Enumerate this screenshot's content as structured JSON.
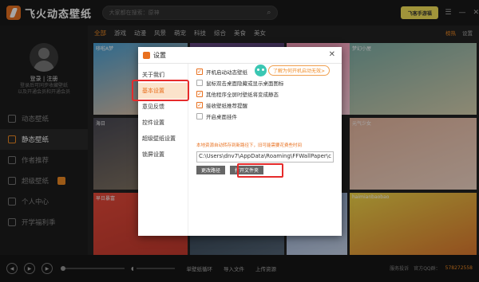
{
  "app": {
    "title": "飞火动态壁纸"
  },
  "search": {
    "placeholder": "大家都在搜索：原神"
  },
  "promo": {
    "label": "飞客手游福"
  },
  "categories": [
    "全部",
    "游戏",
    "动漫",
    "风景",
    "萌宠",
    "科技",
    "综合",
    "美食",
    "美女"
  ],
  "header_links": [
    "榜热",
    "设置"
  ],
  "user": {
    "login": "登录 | 注册",
    "hint1": "登录后可同步收藏壁纸",
    "hint2": "以及开通会员和开通会员"
  },
  "nav": [
    {
      "label": "动态壁纸",
      "active": false
    },
    {
      "label": "静态壁纸",
      "active": true
    },
    {
      "label": "作者推荐",
      "active": false
    },
    {
      "label": "超级壁纸",
      "active": false
    },
    {
      "label": "个人中心",
      "active": false
    },
    {
      "label": "开学福利季",
      "active": false
    }
  ],
  "tiles": [
    {
      "caption": "哆啦A梦",
      "colors": [
        "#4aa3d8",
        "#f3c5a0"
      ]
    },
    {
      "caption": "",
      "colors": [
        "#6c4b8c",
        "#3a3a66"
      ]
    },
    {
      "caption": "",
      "colors": [
        "#ff9fbf",
        "#ffd5e2"
      ]
    },
    {
      "caption": "梦幻小屋",
      "colors": [
        "#7fb0a8",
        "#d9d2b0"
      ]
    },
    {
      "caption": "海日",
      "colors": [
        "#4a4a55",
        "#8a7a66"
      ]
    },
    {
      "caption": "",
      "colors": [
        "#c77a7a",
        "#e8c0a0"
      ]
    },
    {
      "caption": "元气少女",
      "colors": [
        "#e8b8a0",
        "#f4d8c8"
      ]
    },
    {
      "caption": "早日暴富",
      "colors": [
        "#e84a3a",
        "#c63a2e"
      ]
    },
    {
      "caption": "",
      "colors": [
        "#2a3a4a",
        "#556677"
      ]
    },
    {
      "caption": "",
      "colors": [
        "#8fa8d0",
        "#c7d4ea"
      ]
    },
    {
      "caption": "haimianbaobao",
      "colors": [
        "#f2d84a",
        "#e07a30"
      ]
    }
  ],
  "player": {
    "loop": "单壁纸循环",
    "import": "导入文件",
    "upload": "上传资源",
    "service": "服务投诉",
    "qq_label": "官方QQ群：",
    "qq": "578272558"
  },
  "dialog": {
    "title": "设置",
    "nav": [
      "关于我们",
      "基本设置",
      "意见反馈",
      "控件设置",
      "超级壁纸设置",
      "锁屏设置"
    ],
    "options": [
      {
        "label": "开机启动动态壁纸",
        "checked": true
      },
      {
        "label": "鼠标双击桌面隐藏或显示桌面图标",
        "checked": false
      },
      {
        "label": "其他程序全屏时壁纸将变成静态",
        "checked": true
      },
      {
        "label": "接收壁纸推荐提醒",
        "checked": true
      },
      {
        "label": "开启桌面挂件",
        "checked": false
      }
    ],
    "mascot_bubble": "了解为何开机启动无效>",
    "path_note": "本地资源自动转存到新路径下，旧可能需要花费些时间",
    "path": "C:\\Users\\dnv7\\AppData\\Roaming\\FFWallPaper\\c",
    "change_path": "更改路径",
    "open_folder": "打开文件夹"
  }
}
